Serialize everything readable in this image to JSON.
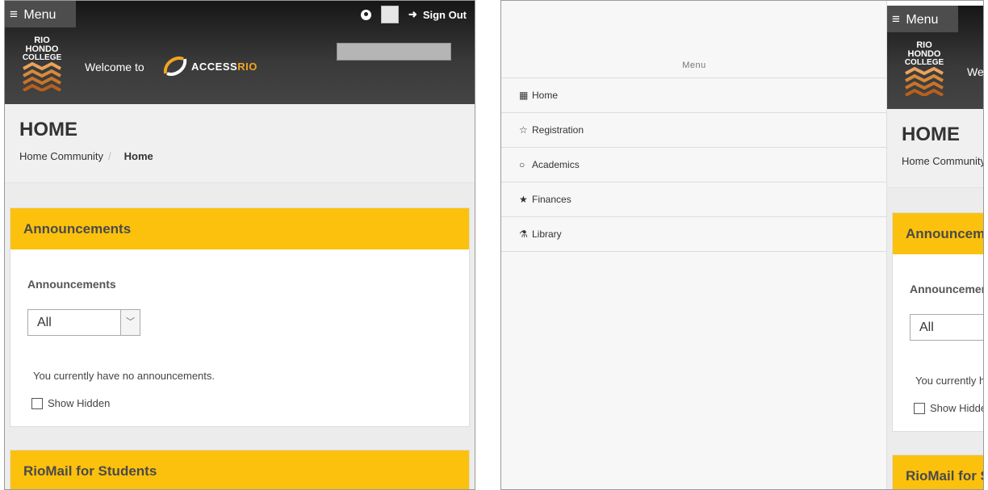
{
  "left": {
    "header": {
      "menu_label": "Menu",
      "signout_label": "Sign Out",
      "logo_line1": "RIO",
      "logo_line2": "HONDO",
      "logo_line3": "COLLEGE",
      "welcome": "Welcome to",
      "brand_access": "ACCESS",
      "brand_rio": "RIO"
    },
    "title": "HOME",
    "breadcrumb": {
      "home_community": "Home Community",
      "separator": "/",
      "current": "Home"
    },
    "announcements_panel": {
      "header": "Announcements",
      "label": "Announcements",
      "select_value": "All",
      "empty_message": "You currently have no announcements.",
      "show_hidden": "Show Hidden"
    },
    "riomail_panel": {
      "header": "RioMail for Students"
    }
  },
  "right": {
    "drawer": {
      "title": "Menu",
      "items": [
        {
          "label": "Home",
          "icon": "grid-icon"
        },
        {
          "label": "Registration",
          "icon": "star-outline-icon"
        },
        {
          "label": "Academics",
          "icon": "circle-icon"
        },
        {
          "label": "Finances",
          "icon": "star-half-icon"
        },
        {
          "label": "Library",
          "icon": "flask-icon"
        }
      ]
    }
  },
  "colors": {
    "accent": "#fcc10d",
    "header_dark": "#2b2b2b",
    "brand_orange": "#f2a522"
  }
}
